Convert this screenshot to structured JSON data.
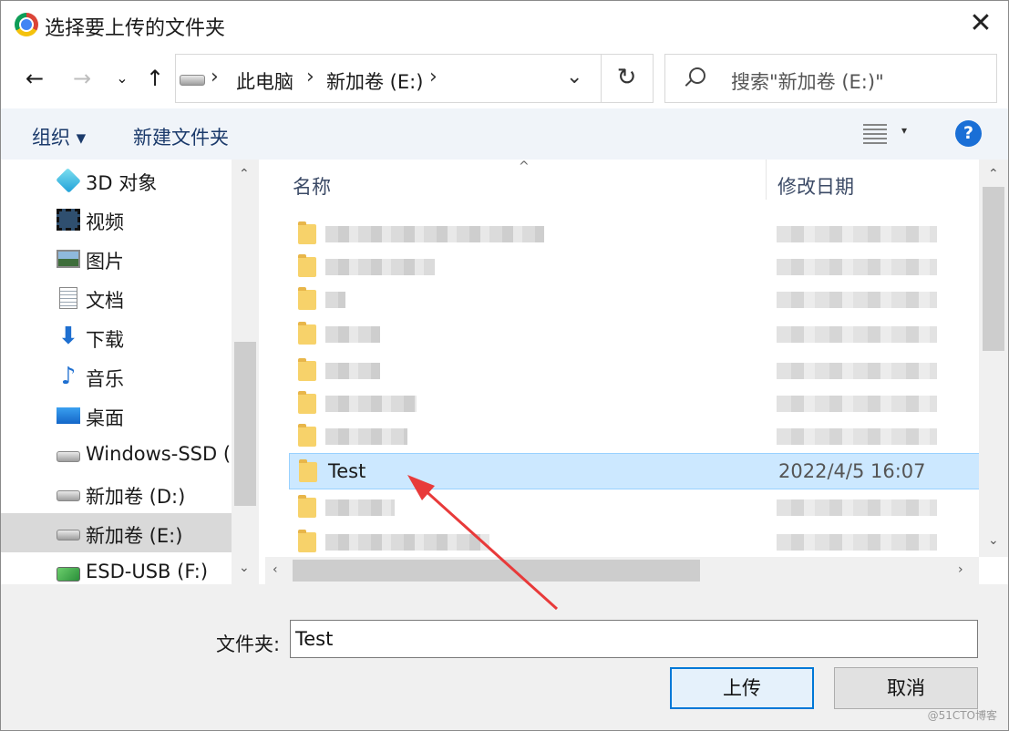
{
  "window": {
    "title": "选择要上传的文件夹",
    "close_glyph": "✕"
  },
  "address": {
    "crumbs": [
      "此电脑",
      "新加卷 (E:)"
    ],
    "search_placeholder": "搜索\"新加卷 (E:)\""
  },
  "toolbar": {
    "organize": "组织 ▾",
    "new_folder": "新建文件夹",
    "help": "?"
  },
  "nav": {
    "items": [
      {
        "label": "3D 对象",
        "icon": "3d-objects-icon"
      },
      {
        "label": "视频",
        "icon": "video-icon"
      },
      {
        "label": "图片",
        "icon": "pictures-icon"
      },
      {
        "label": "文档",
        "icon": "documents-icon"
      },
      {
        "label": "下载",
        "icon": "download-icon"
      },
      {
        "label": "音乐",
        "icon": "music-icon"
      },
      {
        "label": "桌面",
        "icon": "desktop-icon"
      },
      {
        "label": "Windows-SSD (",
        "icon": "windows-drive-icon"
      },
      {
        "label": "新加卷 (D:)",
        "icon": "drive-icon"
      },
      {
        "label": "新加卷 (E:)",
        "icon": "drive-icon",
        "selected": true
      },
      {
        "label": "ESD-USB (F:)",
        "icon": "usb-drive-icon"
      }
    ]
  },
  "list": {
    "columns": {
      "name": "名称",
      "modified": "修改日期"
    },
    "selected_row": {
      "name": "Test",
      "modified": "2022/4/5 16:07"
    }
  },
  "footer": {
    "folder_label": "文件夹:",
    "folder_value": "Test",
    "upload_button": "上传",
    "cancel_button": "取消",
    "watermark": "@51CTO博客"
  },
  "colors": {
    "selection": "#cce8ff",
    "accent": "#0078d7",
    "annotation_arrow": "#e83a3a"
  }
}
